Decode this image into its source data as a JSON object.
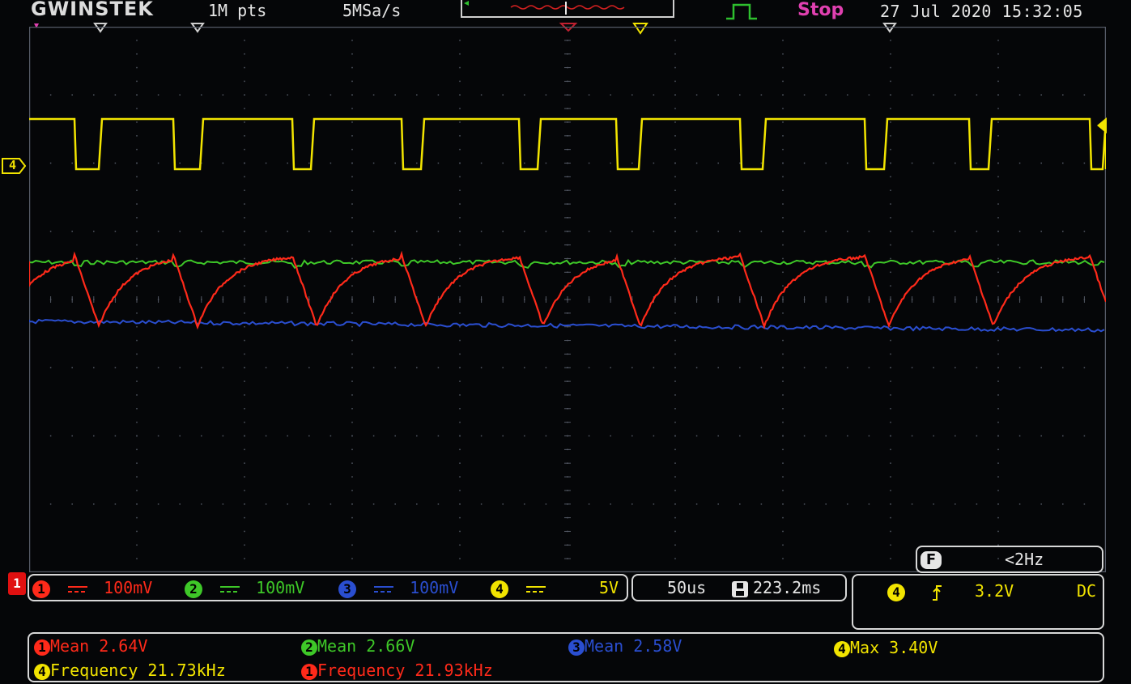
{
  "top_bar": {
    "brand": "GWINSTEK",
    "memory": "1M pts",
    "sample_rate": "5MSa/s",
    "run_state": "Stop",
    "datetime": "27 Jul 2020 15:32:05"
  },
  "colors": {
    "ch1": "#ff2a1a",
    "ch2": "#3ec828",
    "ch3": "#2a4ed0",
    "ch4": "#f2e400",
    "stop": "#e040b0",
    "text": "#e6e6e6",
    "grid": "#555a66"
  },
  "markers": {
    "ch4": "4",
    "ch1": "1"
  },
  "channels": [
    {
      "num": "1",
      "coupling_icon": "dc-coupling-icon",
      "scale": "100mV"
    },
    {
      "num": "2",
      "coupling_icon": "dc-coupling-icon",
      "scale": "100mV"
    },
    {
      "num": "3",
      "coupling_icon": "dc-coupling-icon",
      "scale": "100mV"
    },
    {
      "num": "4",
      "coupling_icon": "dc-coupling-icon",
      "scale": "5V"
    }
  ],
  "timebase": {
    "scale": "50us",
    "record_time": "223.2ms"
  },
  "frequency_counter": {
    "label": "F",
    "value": "<2Hz"
  },
  "trigger": {
    "source": "4",
    "slope_icon": "rising-edge-icon",
    "level": "3.2V",
    "coupling": "DC"
  },
  "measurements": [
    {
      "channel": "1",
      "label": "Mean 2.64V"
    },
    {
      "channel": "2",
      "label": "Mean 2.66V"
    },
    {
      "channel": "3",
      "label": "Mean 2.58V"
    },
    {
      "channel": "4",
      "label": "Max 3.40V"
    },
    {
      "channel": "4",
      "label": "Frequency 21.73kHz"
    },
    {
      "channel": "1",
      "label": "Frequency 21.93kHz"
    }
  ]
}
